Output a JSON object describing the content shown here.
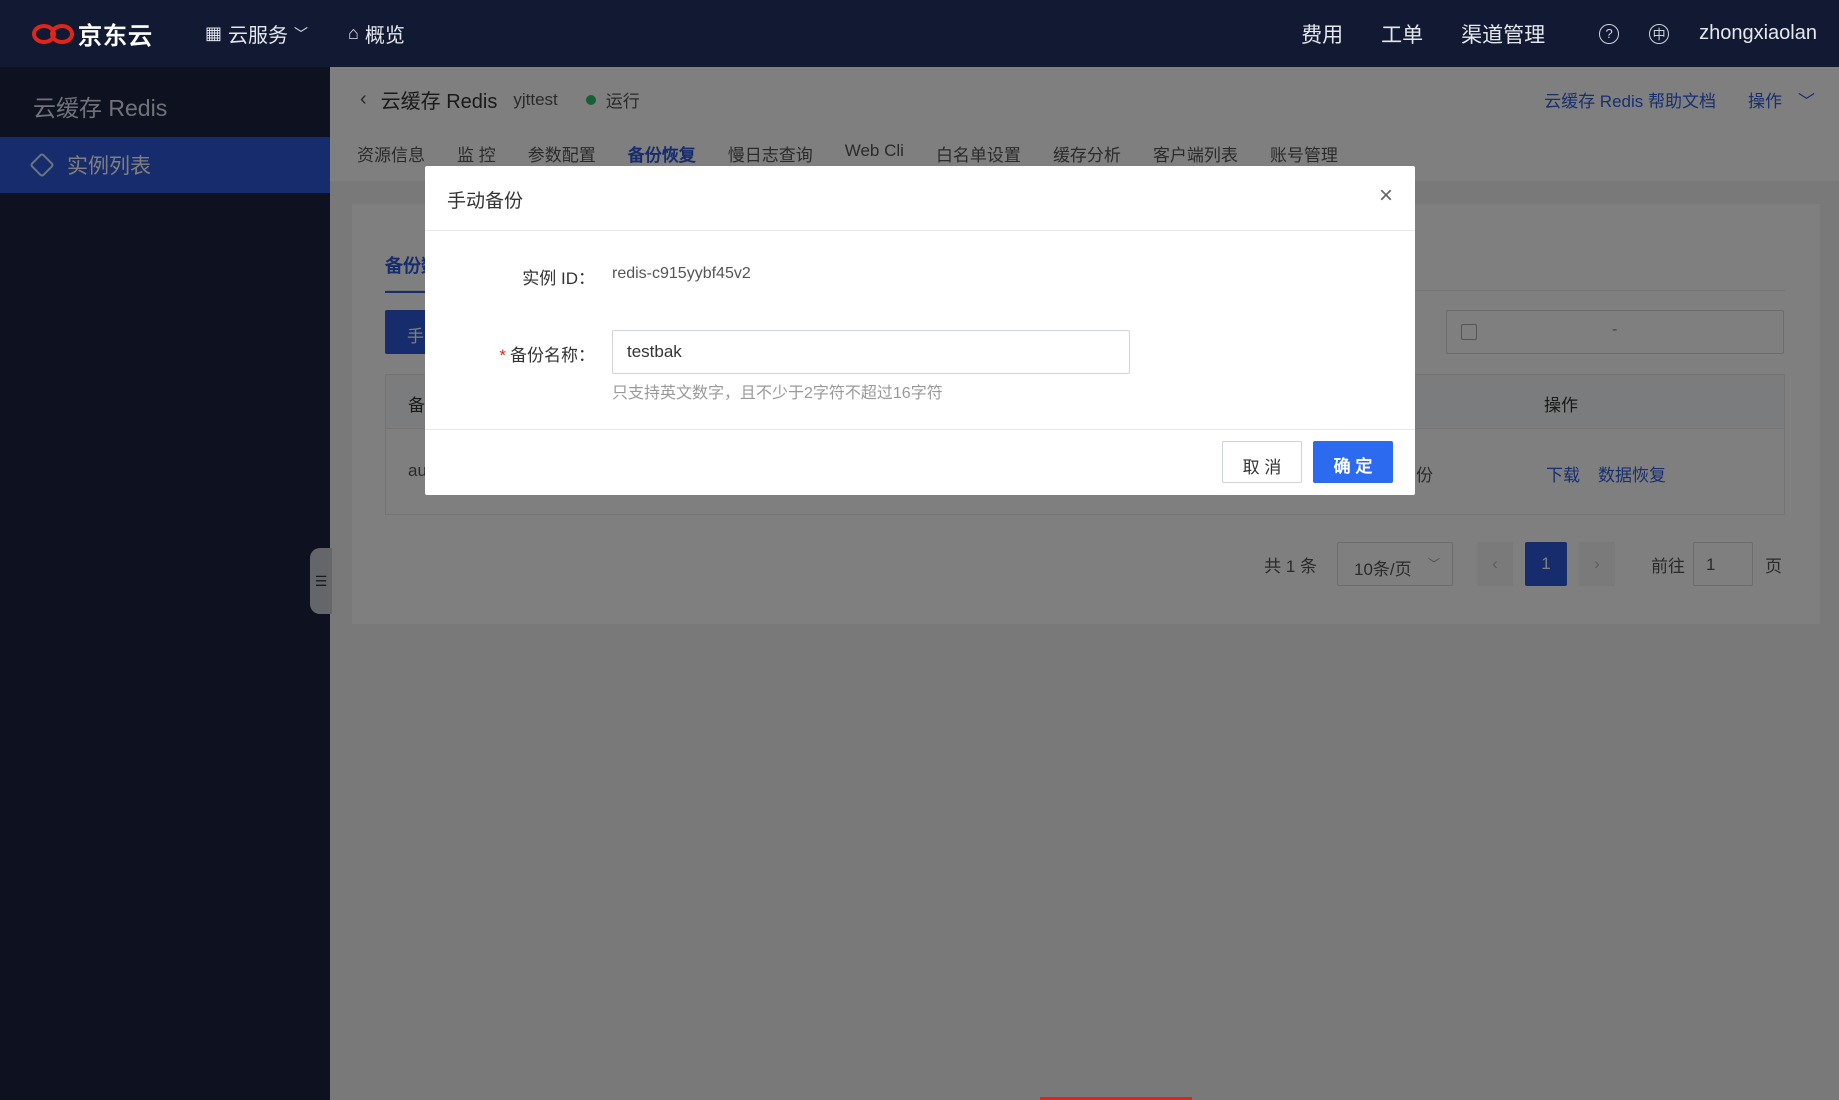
{
  "topbar": {
    "logo_text": "京东云",
    "nav": [
      {
        "label": "云服务",
        "icon": "grid-icon",
        "has_dropdown": true
      },
      {
        "label": "概览",
        "icon": "home-icon",
        "has_dropdown": false
      }
    ],
    "links": [
      "费用",
      "工单",
      "渠道管理"
    ],
    "help_icon": "?",
    "lang_icon": "中",
    "username": "zhongxiaolan"
  },
  "sidebar": {
    "title": "云缓存 Redis",
    "items": [
      {
        "label": "实例列表",
        "icon": "cube-icon",
        "active": true
      }
    ]
  },
  "header": {
    "back_icon": "‹",
    "product": "云缓存 Redis",
    "instance_name": "yjttest",
    "status": "运行",
    "status_color": "#2ebe6a",
    "help_link": "云缓存 Redis 帮助文档",
    "ops_menu": "操作",
    "tabs": [
      {
        "label": "资源信息",
        "active": false
      },
      {
        "label": "监 控",
        "active": false
      },
      {
        "label": "参数配置",
        "active": false
      },
      {
        "label": "备份恢复",
        "active": true
      },
      {
        "label": "慢日志查询",
        "active": false
      },
      {
        "label": "Web Cli",
        "active": false
      },
      {
        "label": "白名单设置",
        "active": false
      },
      {
        "label": "缓存分析",
        "active": false
      },
      {
        "label": "客户端列表",
        "active": false
      },
      {
        "label": "账号管理",
        "active": false
      }
    ]
  },
  "backup_panel": {
    "subtab": "备份数",
    "manual_button": "手",
    "date_separator": "-",
    "table_header_first": "备",
    "table_header_ops": "操作",
    "row_first": "au",
    "row_type": "份",
    "row_actions": [
      "下载",
      "数据恢复"
    ]
  },
  "pager": {
    "total": "共 1 条",
    "page_size": "10条/页",
    "prev": "‹",
    "current": "1",
    "next": "›",
    "goto_label": "前往",
    "goto_value": "1",
    "page_suffix": "页"
  },
  "modal": {
    "title": "手动备份",
    "close_icon": "×",
    "instance_id_label": "实例 ID：",
    "instance_id_value": "redis-c915yybf45v2",
    "required_mark": "*",
    "backup_name_label": "备份名称：",
    "backup_name_value": "testbak",
    "hint": "只支持英文数字，且不少于2字符不超过16字符",
    "cancel": "取 消",
    "confirm": "确 定"
  },
  "colors": {
    "topbar_bg": "#121a33",
    "sidebar_bg": "#1b2240",
    "accent": "#2c59d9",
    "brand_red": "#e1251b",
    "confirm_button": "#2c6bf0"
  }
}
